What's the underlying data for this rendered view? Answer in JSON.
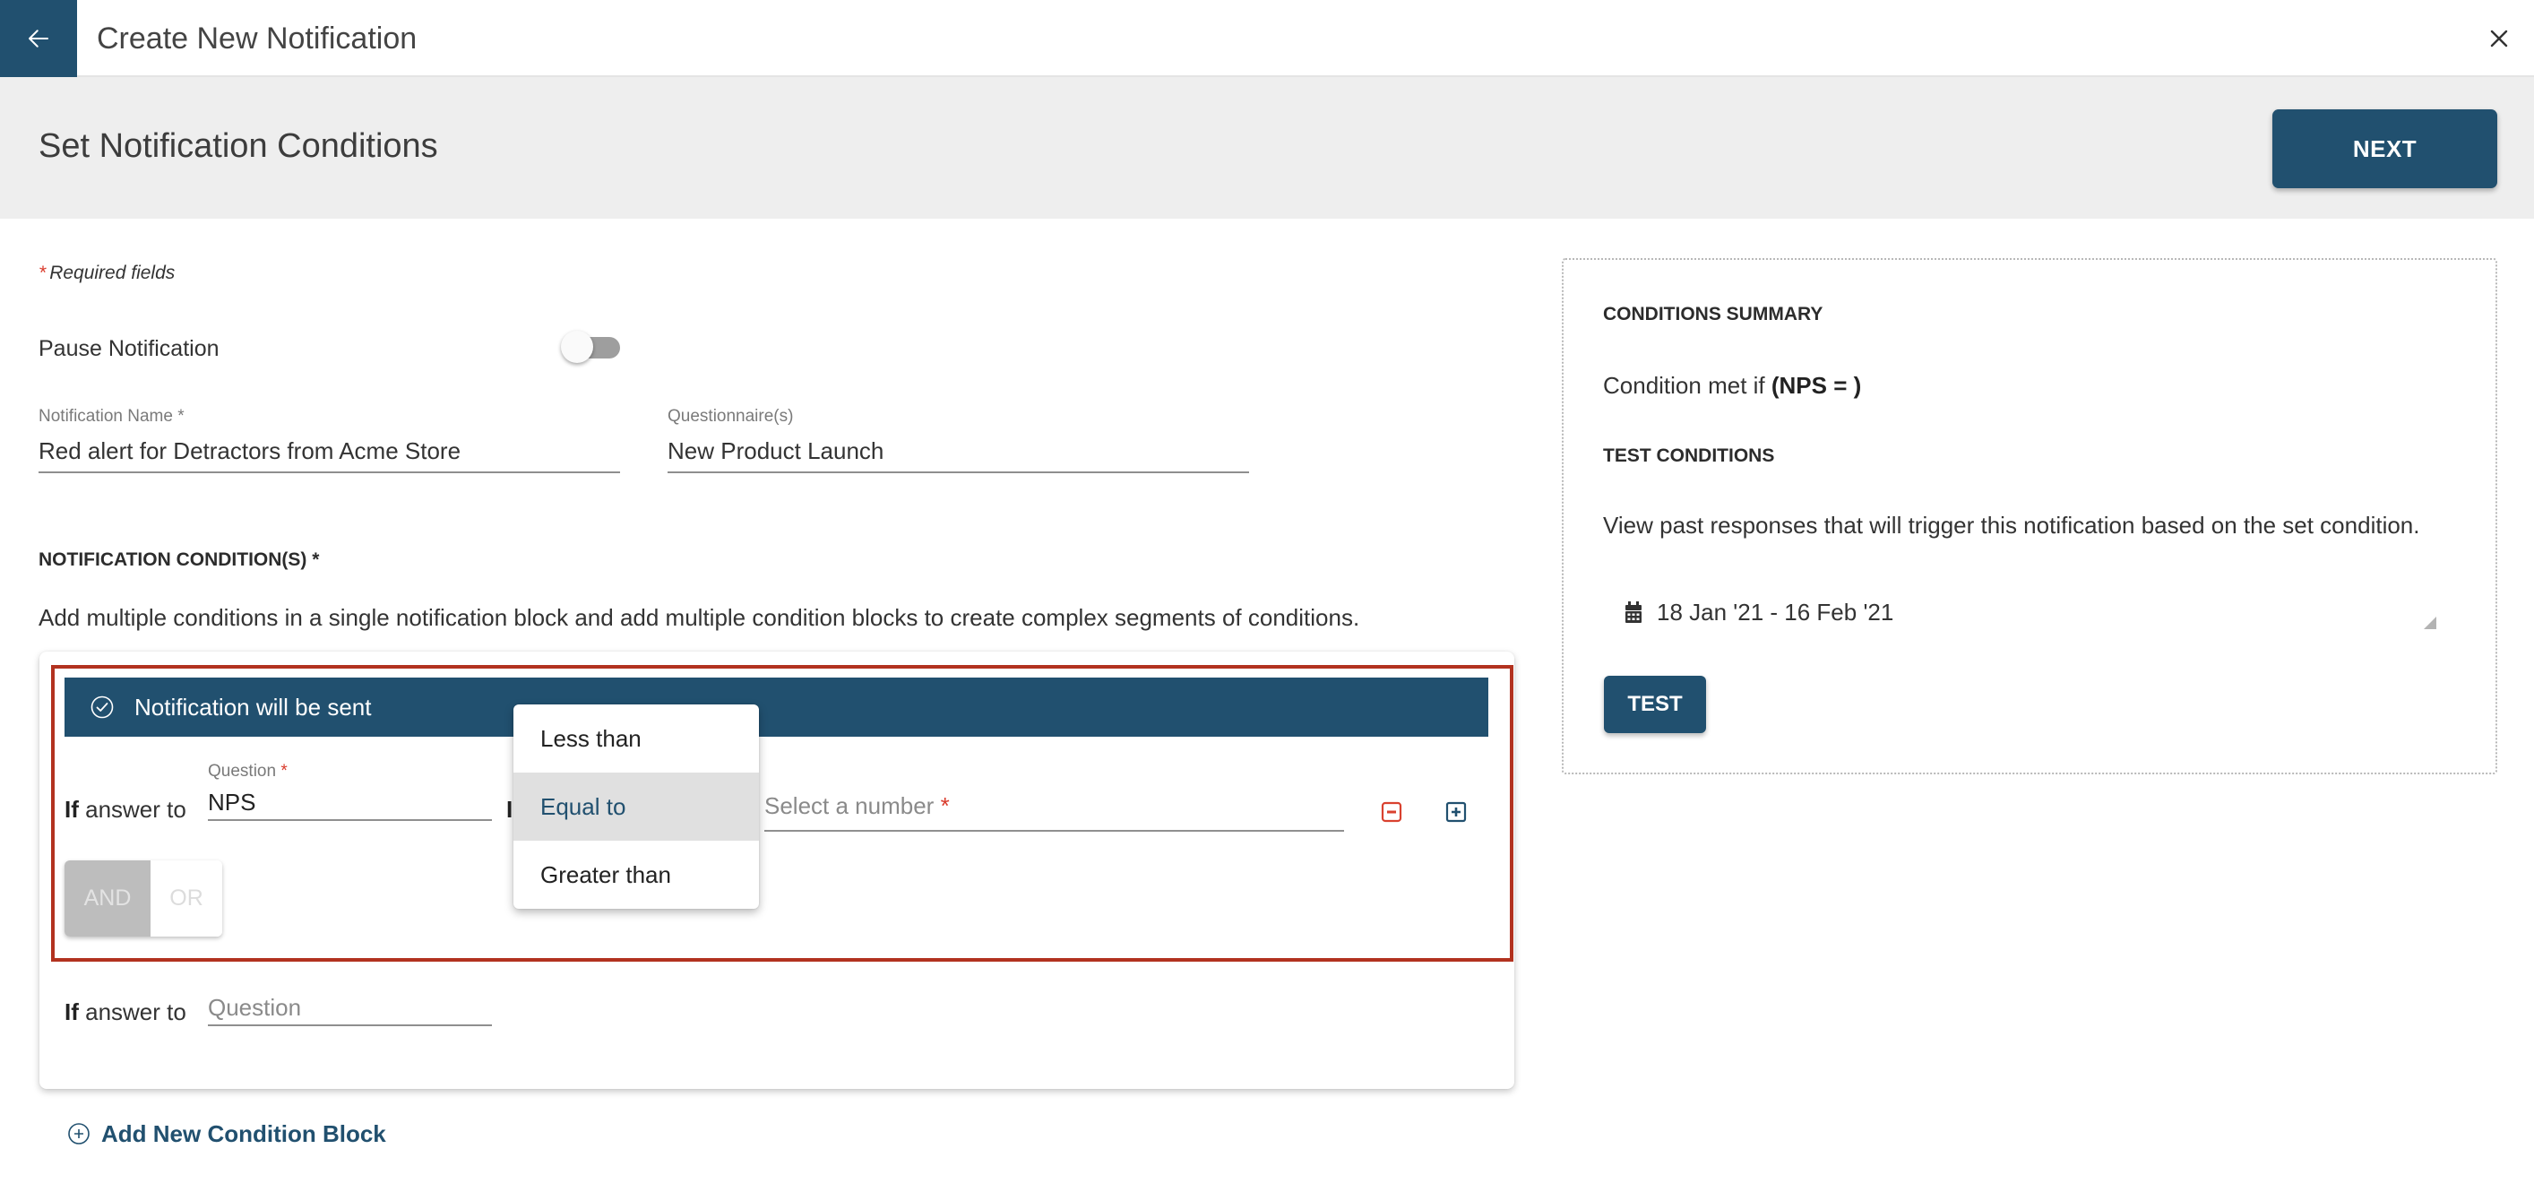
{
  "header": {
    "title": "Create New Notification",
    "back_icon": "arrow-left-icon",
    "close_icon": "close-icon"
  },
  "step": {
    "title": "Set Notification Conditions",
    "next_label": "NEXT"
  },
  "form": {
    "required_star": "*",
    "required_note": "Required fields",
    "pause_label": "Pause Notification",
    "pause_enabled": false,
    "notification_name": {
      "label": "Notification Name *",
      "value": "Red alert for Detractors from Acme Store"
    },
    "questionnaire": {
      "label": "Questionnaire(s)",
      "value": "New Product Launch"
    }
  },
  "conditions": {
    "heading": "NOTIFICATION CONDITION(S) *",
    "description": "Add multiple conditions in a single notification block and add multiple condition blocks to create complex segments of conditions.",
    "block": {
      "banner_text": "Notification will be sent",
      "row1": {
        "if_bold": "If",
        "if_rest": " answer to",
        "question_label": "Question",
        "question_star": "*",
        "question_value": "NPS",
        "operator_hidden_text": "I",
        "number_placeholder": "Select a number",
        "number_star": "*"
      },
      "logic": {
        "and_label": "AND",
        "or_label": "OR"
      },
      "row2": {
        "if_bold": "If",
        "if_rest": " answer to",
        "question_placeholder": "Question"
      }
    },
    "operator_menu": {
      "options": [
        "Less than",
        "Equal to",
        "Greater than"
      ],
      "selected": "Equal to"
    },
    "add_block_label": "Add New Condition Block"
  },
  "summary": {
    "heading": "CONDITIONS SUMMARY",
    "text_prefix": "Condition met if ",
    "text_bold": "(NPS = )",
    "test_heading": "TEST CONDITIONS",
    "test_description": "View past responses that will trigger this notification based on the set condition.",
    "date_range": "18 Jan '21 - 16 Feb '21",
    "test_label": "TEST"
  },
  "colors": {
    "primary": "#21506f",
    "highlight_border": "#b2321f",
    "required": "#d93a2b",
    "band": "#eeeeee"
  }
}
